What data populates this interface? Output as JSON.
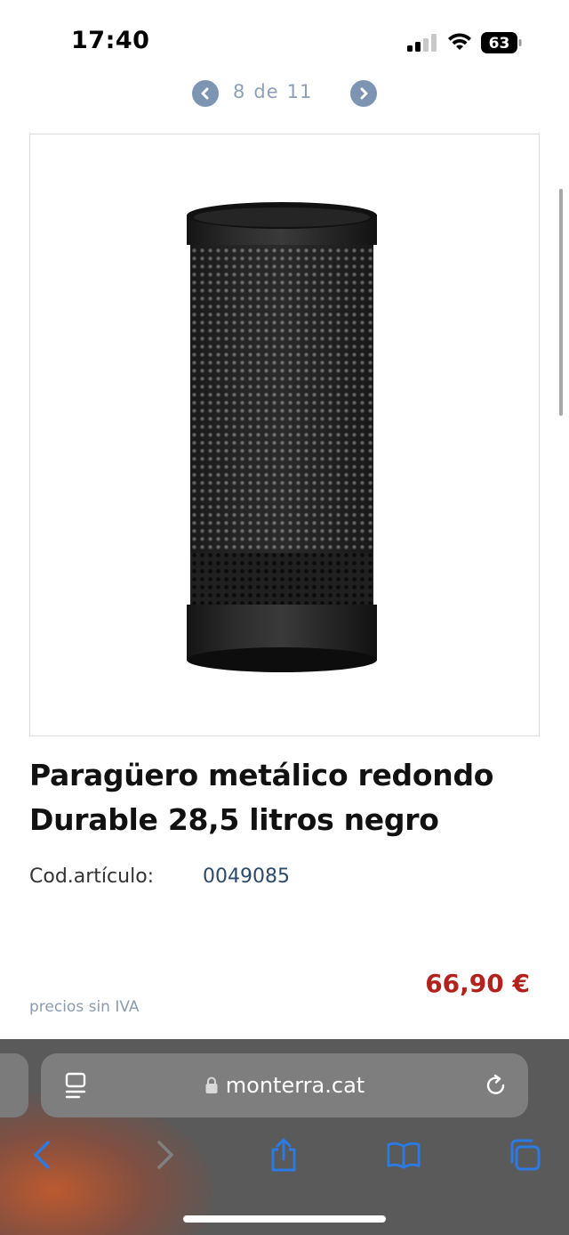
{
  "status_bar": {
    "time": "17:40",
    "battery": "63"
  },
  "pager": {
    "current": "8",
    "separator": "de",
    "total": "11"
  },
  "product": {
    "title_line1": "Paragüero metálico redondo",
    "title_line2": "Durable 28,5 litros negro",
    "code_label": "Cod.artículo:",
    "code_value": "0049085",
    "price": "66,90 €",
    "tax_note": "precios sin IVA"
  },
  "browser": {
    "url": "monterra.cat",
    "toolbar": [
      "back-icon",
      "forward-icon",
      "share-icon",
      "bookmarks-icon",
      "tabs-icon"
    ]
  },
  "colors": {
    "price": "#b3231d",
    "accent_blue": "#2a7be4",
    "code_value": "#2c4a6b",
    "pager_button": "#7d95b3"
  }
}
